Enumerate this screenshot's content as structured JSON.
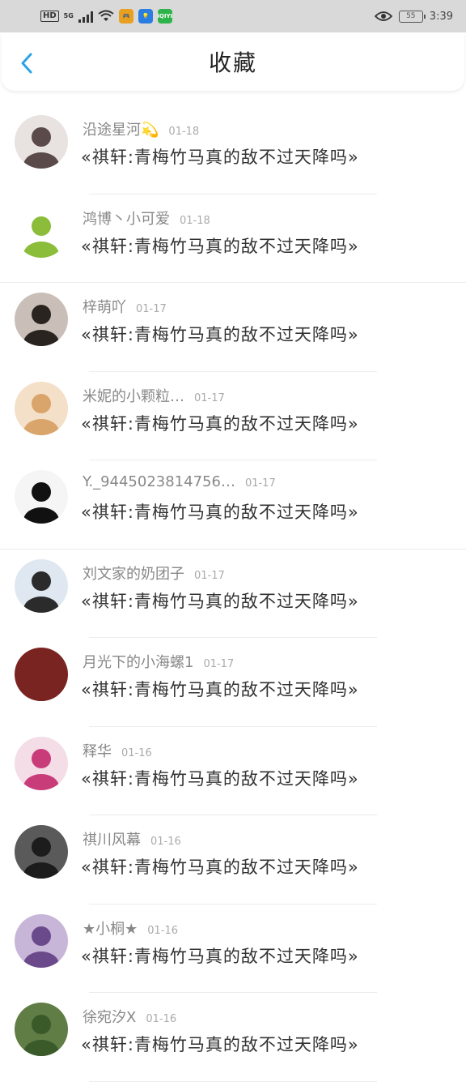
{
  "status_bar": {
    "hd": "HD",
    "network": "5G",
    "battery": "55",
    "time": "3:39",
    "apps": [
      {
        "name": "game-app-icon",
        "color": "#e8a020"
      },
      {
        "name": "bulb-app-icon",
        "color": "#2a7de1"
      },
      {
        "name": "iqiyi-app-icon",
        "color": "#2db34a",
        "text": "iQIYI"
      }
    ]
  },
  "header": {
    "title": "收藏"
  },
  "items": [
    {
      "name": "沿途星河💫",
      "date": "01-18",
      "message": "«祺轩:青梅竹马真的敌不过天降吗»",
      "avatar_color": "#5a4a4a",
      "avatar_bg": "#e8e3e0"
    },
    {
      "name": "鸿博丶小可爱",
      "date": "01-18",
      "message": "«祺轩:青梅竹马真的敌不过天降吗»",
      "avatar_color": "#8bbd3a",
      "avatar_bg": "#ffffff"
    },
    {
      "name": "梓萌吖",
      "date": "01-17",
      "message": "«祺轩:青梅竹马真的敌不过天降吗»",
      "avatar_color": "#2a2420",
      "avatar_bg": "#c9bfb8"
    },
    {
      "name": "米妮的小颗粒…",
      "date": "01-17",
      "message": "«祺轩:青梅竹马真的敌不过天降吗»",
      "avatar_color": "#d9a56a",
      "avatar_bg": "#f4e0c8"
    },
    {
      "name": "Y._9445023814756…",
      "date": "01-17",
      "message": "«祺轩:青梅竹马真的敌不过天降吗»",
      "avatar_color": "#111111",
      "avatar_bg": "#f5f5f5"
    },
    {
      "name": "刘文家的奶团子",
      "date": "01-17",
      "message": "«祺轩:青梅竹马真的敌不过天降吗»",
      "avatar_color": "#2b2b2b",
      "avatar_bg": "#dfe8f0"
    },
    {
      "name": "月光下的小海螺1",
      "date": "01-17",
      "message": "«祺轩:青梅竹马真的敌不过天降吗»",
      "avatar_color": "#7a2422",
      "avatar_bg": "#7a2422"
    },
    {
      "name": "释华",
      "date": "01-16",
      "message": "«祺轩:青梅竹马真的敌不过天降吗»",
      "avatar_color": "#c83c7a",
      "avatar_bg": "#f4dde6"
    },
    {
      "name": "祺川风幕",
      "date": "01-16",
      "message": "«祺轩:青梅竹马真的敌不过天降吗»",
      "avatar_color": "#1c1c1c",
      "avatar_bg": "#5a5a5a"
    },
    {
      "name": "★小桐★",
      "date": "01-16",
      "message": "«祺轩:青梅竹马真的敌不过天降吗»",
      "avatar_color": "#6a4a8a",
      "avatar_bg": "#c8b6d8"
    },
    {
      "name": "徐宛汐X",
      "date": "01-16",
      "message": "«祺轩:青梅竹马真的敌不过天降吗»",
      "avatar_color": "#3a5a2a",
      "avatar_bg": "#5f7d44"
    }
  ]
}
